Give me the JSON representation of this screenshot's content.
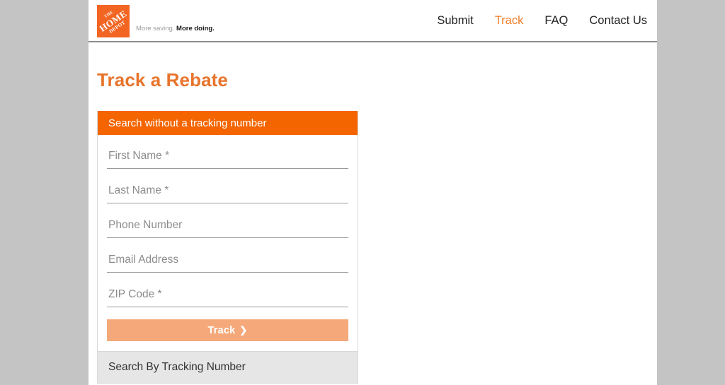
{
  "header": {
    "logo": {
      "icon": "home-depot-logo-icon",
      "line1": "THE",
      "line2": "HOME",
      "line3": "DEPOT"
    },
    "tagline_light": "More saving.",
    "tagline_bold": "More doing.",
    "nav": [
      {
        "label": "Submit",
        "active": false
      },
      {
        "label": "Track",
        "active": true
      },
      {
        "label": "FAQ",
        "active": false
      },
      {
        "label": "Contact Us",
        "active": false
      }
    ]
  },
  "page": {
    "title": "Track a Rebate"
  },
  "search_panel": {
    "header_label": "Search without a tracking number",
    "fields": [
      {
        "placeholder": "First Name *",
        "value": "",
        "name": "first-name-input"
      },
      {
        "placeholder": "Last Name *",
        "value": "",
        "name": "last-name-input"
      },
      {
        "placeholder": "Phone Number",
        "value": "",
        "name": "phone-number-input"
      },
      {
        "placeholder": "Email Address",
        "value": "",
        "name": "email-address-input"
      },
      {
        "placeholder": "ZIP Code *",
        "value": "",
        "name": "zip-code-input"
      }
    ],
    "submit_label": "Track",
    "submit_chevron": "❯",
    "footer_label": "Search By Tracking Number"
  },
  "colors": {
    "brand_orange": "#f46500",
    "title_orange": "#e8742c",
    "nav_active_orange": "#f07d28",
    "button_peach": "#f5a97b",
    "page_background_gray": "#c4c4c4",
    "footer_gray": "#e6e6e6"
  }
}
